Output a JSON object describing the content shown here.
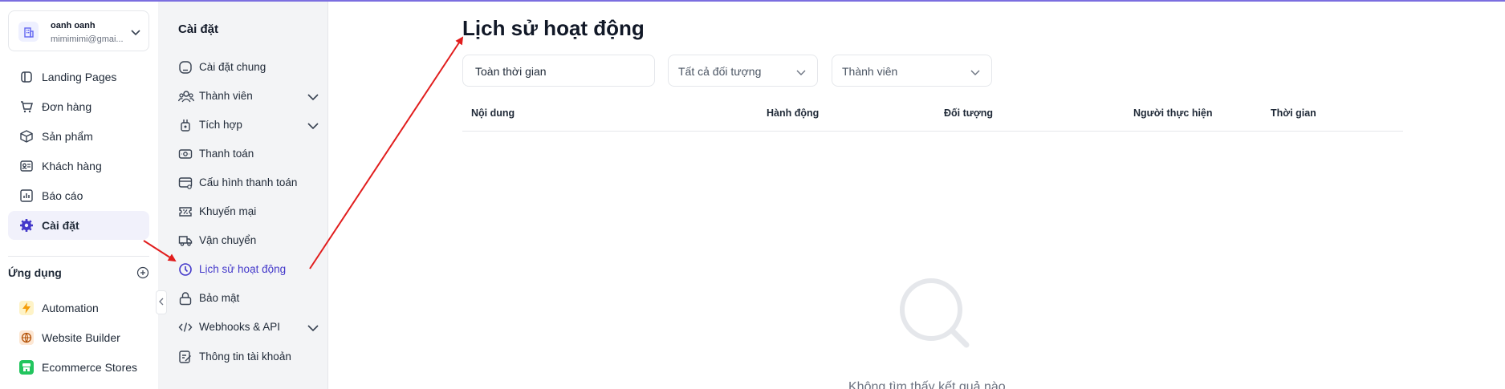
{
  "account": {
    "name": "oanh oanh",
    "email": "mimimimi@gmai..."
  },
  "nav": [
    {
      "label": "Landing Pages",
      "icon": "landing-pages-icon"
    },
    {
      "label": "Đơn hàng",
      "icon": "orders-icon"
    },
    {
      "label": "Sản phẩm",
      "icon": "products-icon"
    },
    {
      "label": "Khách hàng",
      "icon": "customers-icon"
    },
    {
      "label": "Báo cáo",
      "icon": "reports-icon"
    },
    {
      "label": "Cài đặt",
      "icon": "gear-icon",
      "active": true
    }
  ],
  "apps": {
    "title": "Ứng dụng",
    "items": [
      {
        "label": "Automation",
        "icon": "lightning-icon",
        "color": "#f59e0b"
      },
      {
        "label": "Website Builder",
        "icon": "globe-icon",
        "color": "#b45309"
      },
      {
        "label": "Ecommerce Stores",
        "icon": "store-icon",
        "color": "#22c55e"
      }
    ]
  },
  "settings": {
    "title": "Cài đặt",
    "items": [
      {
        "label": "Cài đặt chung",
        "icon": "general-settings-icon"
      },
      {
        "label": "Thành viên",
        "icon": "members-icon",
        "expandable": true
      },
      {
        "label": "Tích hợp",
        "icon": "integration-icon",
        "expandable": true
      },
      {
        "label": "Thanh toán",
        "icon": "payment-icon"
      },
      {
        "label": "Cấu hình thanh toán",
        "icon": "payment-config-icon"
      },
      {
        "label": "Khuyến mại",
        "icon": "promotion-icon"
      },
      {
        "label": "Vận chuyển",
        "icon": "shipping-icon"
      },
      {
        "label": "Lịch sử hoạt động",
        "icon": "history-icon",
        "active": true
      },
      {
        "label": "Bảo mật",
        "icon": "lock-icon"
      },
      {
        "label": "Webhooks & API",
        "icon": "code-icon",
        "expandable": true
      },
      {
        "label": "Thông tin tài khoản",
        "icon": "account-info-icon"
      }
    ]
  },
  "main": {
    "title": "Lịch sử hoạt động",
    "filters": {
      "time": "Toàn thời gian",
      "object": "Tất cả đối tượng",
      "member": "Thành viên"
    },
    "columns": [
      "Nội dung",
      "Hành động",
      "Đối tượng",
      "Người thực hiện",
      "Thời gian"
    ],
    "empty_text": "Không tìm thấy kết quả nào"
  },
  "colors": {
    "accent": "#4338ca",
    "arrow": "#e11d1d",
    "active_bg": "#f1f1fb",
    "panel_bg": "#f3f4f6"
  }
}
